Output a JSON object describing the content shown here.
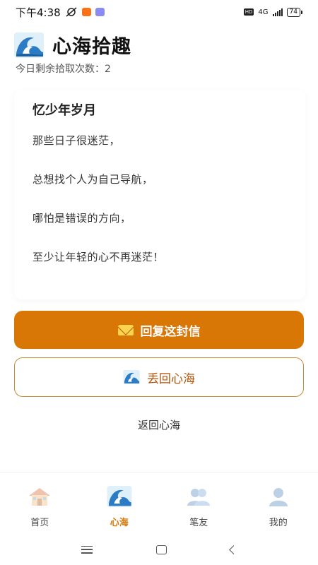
{
  "status_bar": {
    "time": "下午4:38",
    "hd": "HD",
    "network": "4G",
    "battery": "74"
  },
  "header": {
    "title": "心海拾趣",
    "logo_icon": "ocean-wave-icon"
  },
  "remaining": "今日剩余拾取次数：2",
  "letter": {
    "title": "忆少年岁月",
    "lines": [
      "那些日子很迷茫，",
      "总想找个人为自己导航，",
      "哪怕是错误的方向，",
      "至少让年轻的心不再迷茫！"
    ]
  },
  "actions": {
    "reply_label": "回复这封信",
    "toss_label": "丢回心海",
    "back_label": "返回心海"
  },
  "tabs": [
    {
      "label": "首页",
      "icon": "house-icon"
    },
    {
      "label": "心海",
      "icon": "ocean-wave-icon"
    },
    {
      "label": "笔友",
      "icon": "friends-icon"
    },
    {
      "label": "我的",
      "icon": "person-icon"
    }
  ],
  "colors": {
    "accent": "#d97706",
    "wave": "#3b82c4"
  }
}
